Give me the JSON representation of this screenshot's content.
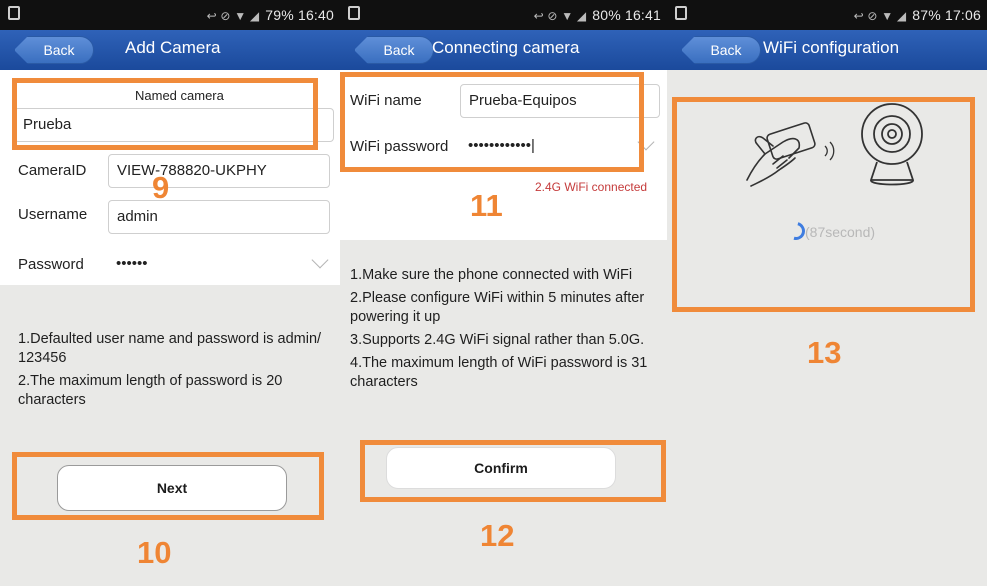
{
  "status_bars": [
    {
      "text": "79% 16:40",
      "icons": "↩ ⊘ ▼ ◢"
    },
    {
      "text": "80% 16:41",
      "icons": "↩ ⊘ ▼ ◢"
    },
    {
      "text": "87% 17:06",
      "icons": "↩ ⊘ ▼ ◢"
    }
  ],
  "screen1": {
    "back_label": "Back",
    "title": "Add Camera",
    "named_camera_label": "Named camera",
    "name_value": "Prueba",
    "camera_id_label": "CameraID",
    "camera_id_value": "VIEW-788820-UKPHY",
    "username_label": "Username",
    "username_value": "admin",
    "password_label": "Password",
    "password_value": "••••••",
    "note1": "1.Defaulted user name and password is admin/ 123456",
    "note2": "2.The maximum length of password is 20 characters",
    "next_label": "Next"
  },
  "screen2": {
    "back_label": "Back",
    "title": "Connecting camera",
    "wifi_name_label": "WiFi name",
    "wifi_name_value": "Prueba-Equipos",
    "wifi_password_label": "WiFi password",
    "wifi_password_value": "••••••••••••|",
    "wifi_status": "2.4G WiFi connected",
    "note1": "1.Make sure the phone connected with WiFi",
    "note2": "2.Please configure WiFi within 5 minutes after powering it up",
    "note3": "3.Supports 2.4G WiFi signal rather than 5.0G.",
    "note4": "4.The maximum length of WiFi password is 31 characters",
    "confirm_label": "Confirm"
  },
  "screen3": {
    "back_label": "Back",
    "title": "WiFi configuration",
    "countdown": "(87second)"
  },
  "steps": {
    "s9": "9",
    "s10": "10",
    "s11": "11",
    "s12": "12",
    "s13": "13"
  },
  "colors": {
    "highlight": "#f08b3b",
    "appbar": "#1b4a9c",
    "wifi_status": "#c53b3b"
  }
}
